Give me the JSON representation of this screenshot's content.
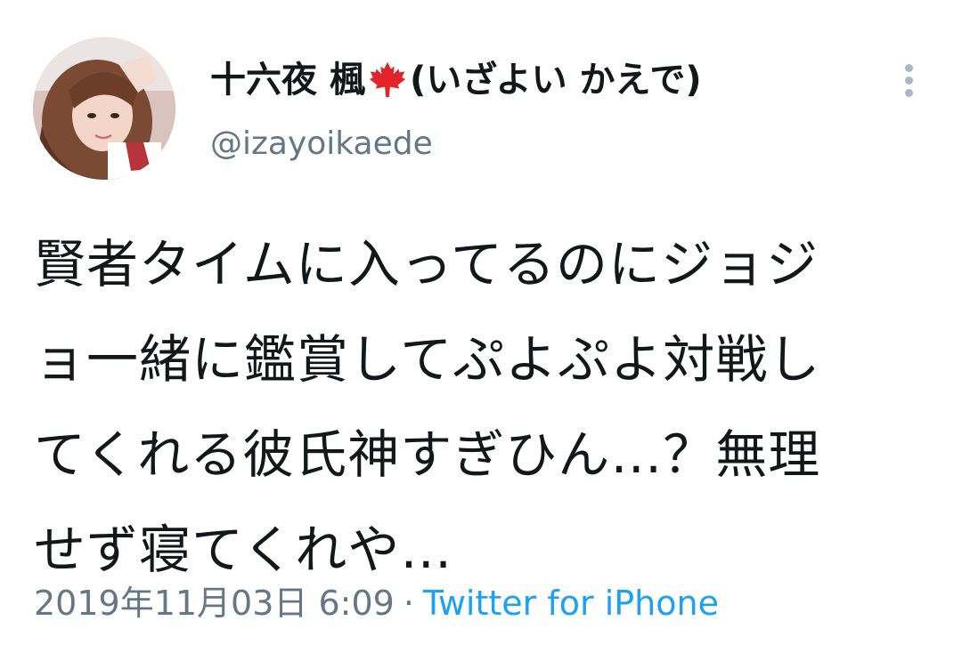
{
  "user": {
    "display_name": "十六夜 楓",
    "display_name_suffix": "(いざよい かえで)",
    "handle": "@izayoikaede",
    "name_emoji": "maple-leaf-icon"
  },
  "tweet": {
    "lines": [
      "賢者タイムに入ってるのにジョジ",
      "ョ一緒に鑑賞してぷよぷよ対戦し",
      "てくれる彼氏神すぎひん…？無理",
      "せず寝てくれや…"
    ],
    "timestamp": "2019年11月03日 6:09",
    "separator": "·",
    "source": "Twitter for iPhone"
  },
  "actions": {
    "more_icon": "more-vertical-icon"
  },
  "colors": {
    "text": "#14171a",
    "secondary": "#657786",
    "link": "#1da1f2",
    "maple": "#e0242a"
  }
}
